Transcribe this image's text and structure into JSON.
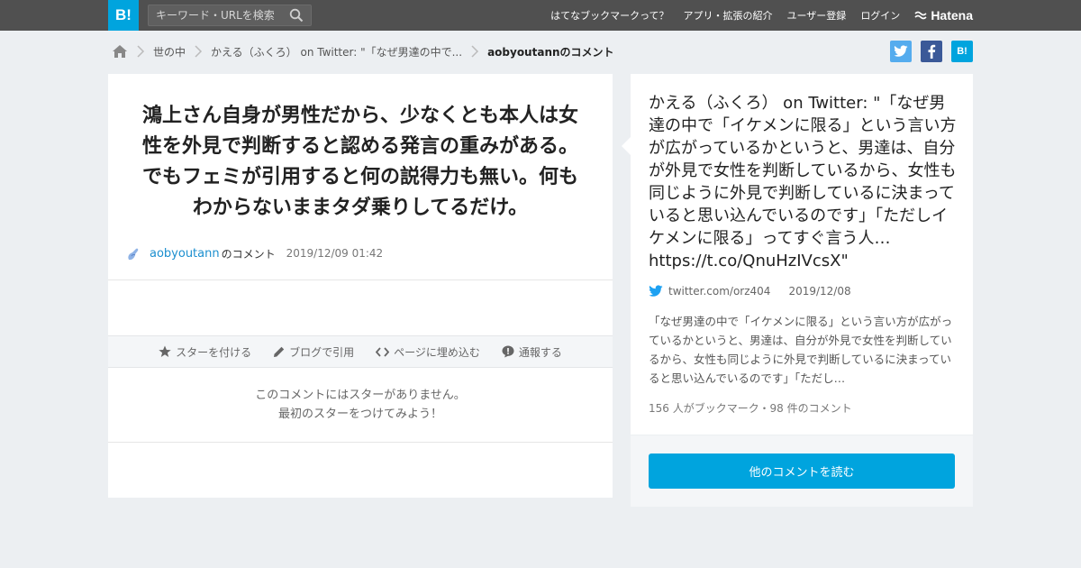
{
  "header": {
    "logo": "B!",
    "search_placeholder": "キーワード・URLを検索",
    "nav": [
      "はてなブックマークって？",
      "アプリ・拡張の紹介",
      "ユーザー登録",
      "ログイン"
    ],
    "brand": "Hatena"
  },
  "breadcrumb": {
    "items": [
      "世の中",
      "かえる（ふくろ） on Twitter: \"「なぜ男達の中で...",
      "aobyoutannのコメント"
    ]
  },
  "share": {
    "twitter": "t",
    "facebook": "f",
    "hatena": "B!"
  },
  "comment": {
    "text": "鴻上さん自身が男性だから、少なくとも本人は女性を外見で判断すると認める発言の重みがある。でもフェミが引用すると何の説得力も無い。何もわからないままタダ乗りしてるだけ。",
    "username": "aobyoutann",
    "suffix": "のコメント",
    "date": "2019/12/09 01:42"
  },
  "actions": {
    "star": "スターを付ける",
    "blog": "ブログで引用",
    "embed": "ページに埋め込む",
    "report": "通報する"
  },
  "nostar": {
    "line1": "このコメントにはスターがありません。",
    "line2": "最初のスターをつけてみよう！"
  },
  "entry": {
    "title": "かえる（ふくろ） on Twitter: \"「なぜ男達の中で「イケメンに限る」という言い方が広がっているかというと、男達は、自分が外見で女性を判断しているから、女性も同じように外見で判断しているに決まっていると思い込んでいるのです」「ただしイケメンに限る」ってすぐ言う人… https://t.co/QnuHzIVcsX\"",
    "source": "twitter.com/orz404",
    "date": "2019/12/08",
    "excerpt": "「なぜ男達の中で「イケメンに限る」という言い方が広がっているかというと、男達は、自分が外見で女性を判断しているから、女性も同じように外見で判断しているに決まっていると思い込んでいるのです」「ただし…",
    "counts": "156 人がブックマーク・98 件のコメント",
    "readmore": "他のコメントを読む"
  },
  "colors": {
    "accent": "#00a4de",
    "header_bg": "#505050",
    "page_bg": "#eceff2",
    "link": "#1c8fcf"
  }
}
